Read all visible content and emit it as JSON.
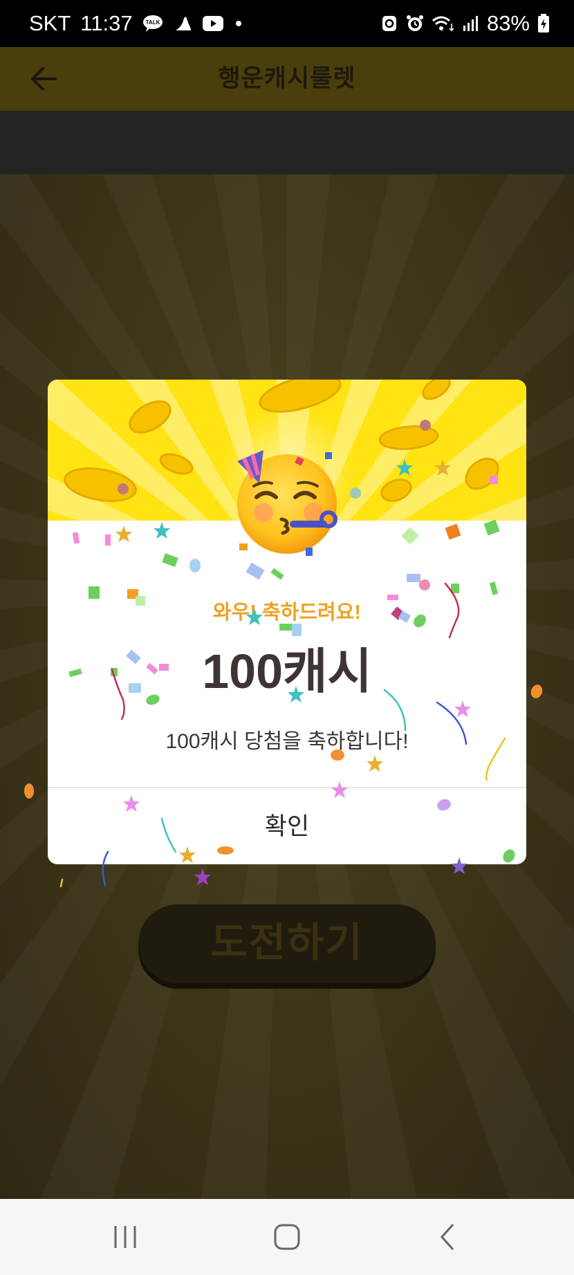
{
  "status_bar": {
    "carrier": "SKT",
    "time": "11:37",
    "talk_badge": "TALK",
    "battery": "83%"
  },
  "app_bar": {
    "title": "행운캐시룰렛"
  },
  "main": {
    "challenge_label": "도전하기"
  },
  "dialog": {
    "subtitle": "와우! 축하드려요!",
    "amount": "100캐시",
    "message": "100캐시 당첨을 축하합니다!",
    "confirm_label": "확인"
  },
  "colors": {
    "header_yellow": "#ffe312",
    "subtitle_orange": "#f0a020",
    "amount_text": "#3e3434"
  },
  "icons": [
    "talk-icon",
    "walk-icon",
    "youtube-icon",
    "dot-icon",
    "recycle-icon",
    "alarm-icon",
    "wifi-icon",
    "signal-icon",
    "battery-icon",
    "back-arrow-icon",
    "party-face-emoji",
    "recent-apps-icon",
    "home-icon",
    "nav-back-icon"
  ]
}
